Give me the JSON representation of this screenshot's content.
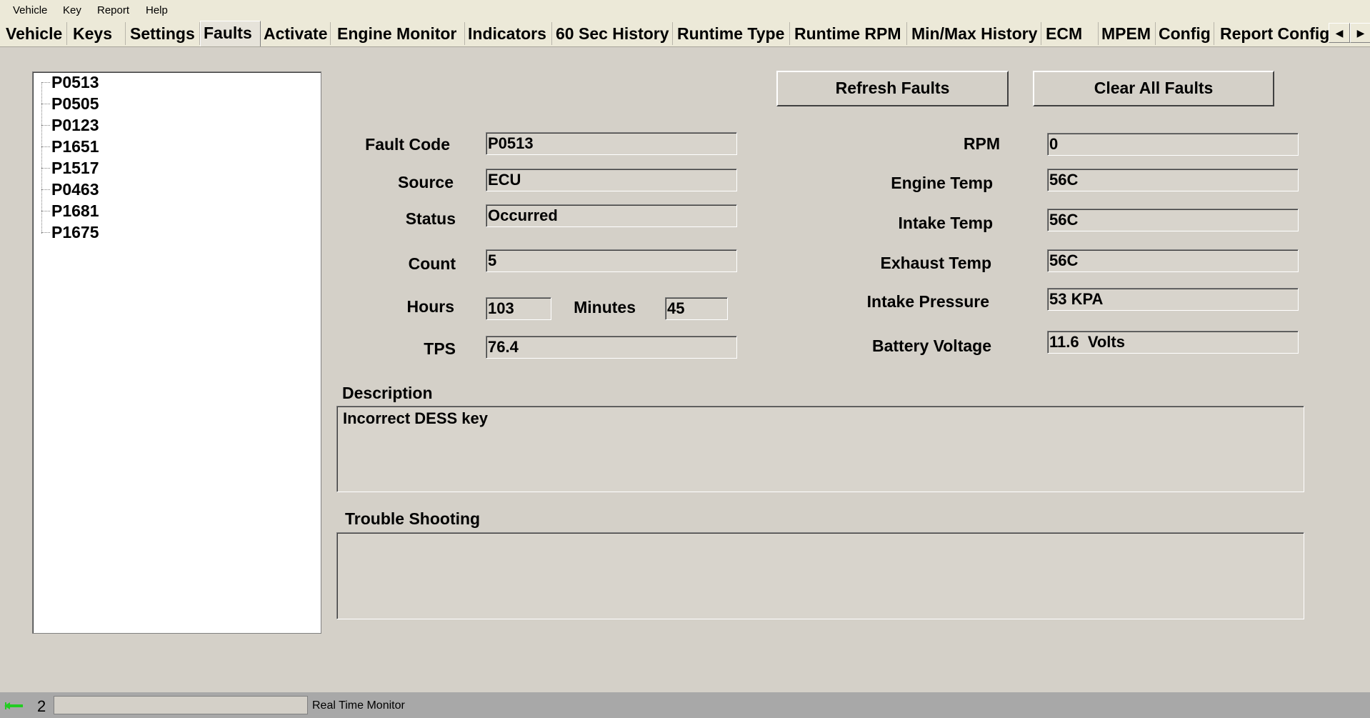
{
  "menu": [
    "Vehicle",
    "Key",
    "Report",
    "Help"
  ],
  "tabs": [
    "Vehicle",
    "Keys",
    "Settings",
    "Faults",
    "Activate",
    "Engine Monitor",
    "Indicators",
    "60 Sec History",
    "Runtime Type",
    "Runtime RPM",
    "Min/Max History",
    "ECM",
    "MPEM",
    "Config",
    "Report Config"
  ],
  "active_tab": "Faults",
  "fault_list": [
    "P0513",
    "P0505",
    "P0123",
    "P1651",
    "P1517",
    "P0463",
    "P1681",
    "P1675"
  ],
  "buttons": {
    "refresh": "Refresh Faults",
    "clear": "Clear All Faults"
  },
  "left": {
    "fault_code": {
      "label": "Fault Code",
      "value": "P0513"
    },
    "source": {
      "label": "Source",
      "value": "ECU"
    },
    "status": {
      "label": "Status",
      "value": "Occurred"
    },
    "count": {
      "label": "Count",
      "value": "5"
    },
    "hours": {
      "label": "Hours",
      "value": "103"
    },
    "minutes": {
      "label": "Minutes",
      "value": "45"
    },
    "tps": {
      "label": "TPS",
      "value": "76.4"
    }
  },
  "right": {
    "rpm": {
      "label": "RPM",
      "value": "0"
    },
    "engine_temp": {
      "label": "Engine Temp",
      "value": "56C"
    },
    "intake_temp": {
      "label": "Intake Temp",
      "value": "56C"
    },
    "exhaust_temp": {
      "label": "Exhaust Temp",
      "value": "56C"
    },
    "intake_pressure": {
      "label": "Intake Pressure",
      "value": "53 KPA"
    },
    "battery_voltage": {
      "label": "Battery Voltage",
      "value": "11.6  Volts"
    }
  },
  "description": {
    "label": "Description",
    "value": "Incorrect DESS key"
  },
  "troubleshooting": {
    "label": "Trouble Shooting",
    "value": ""
  },
  "statusbar": {
    "count": "2",
    "text": "Real Time Monitor",
    "icon": "connection-arrows-icon",
    "icon_color": "#22cc22"
  }
}
